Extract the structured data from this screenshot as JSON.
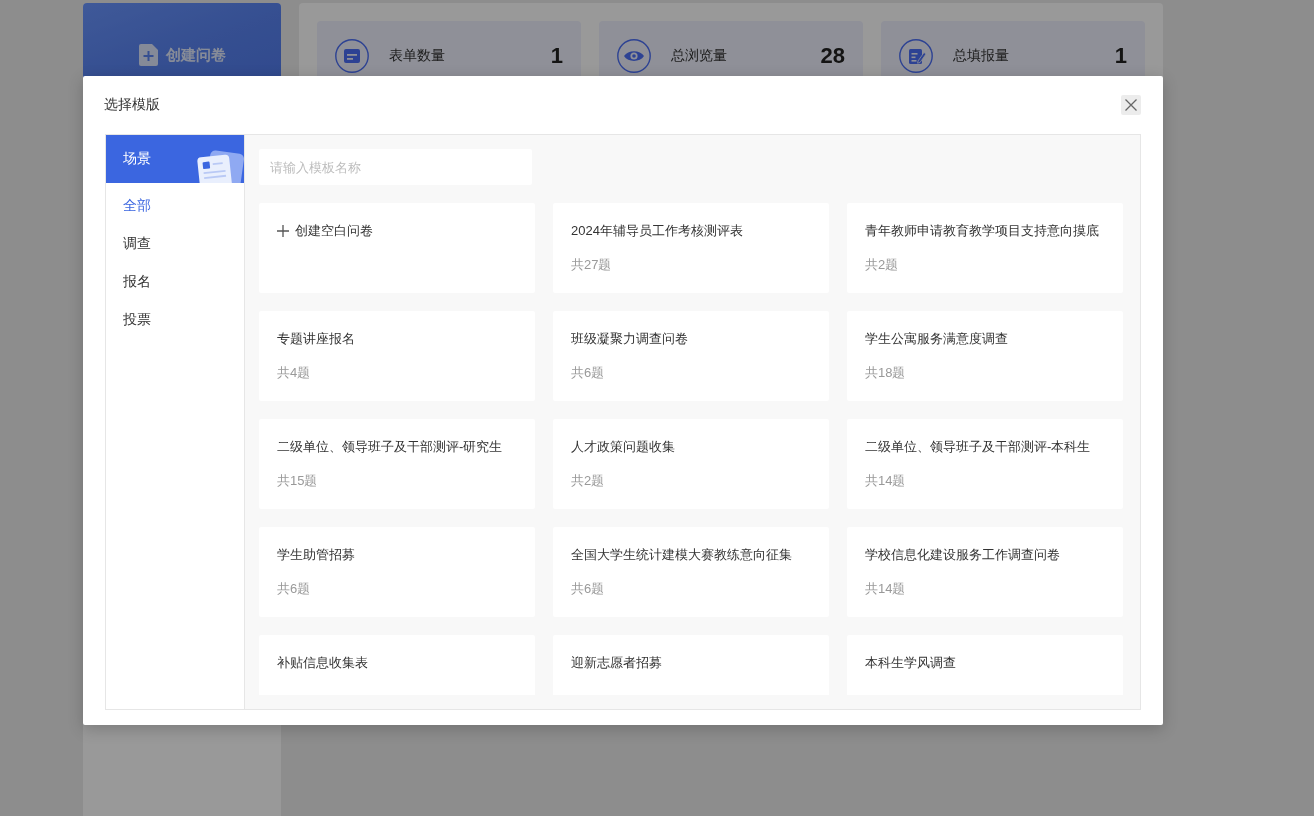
{
  "background": {
    "create_button": "创建问卷",
    "stats": [
      {
        "label": "表单数量",
        "value": "1"
      },
      {
        "label": "总浏览量",
        "value": "28"
      },
      {
        "label": "总填报量",
        "value": "1"
      }
    ]
  },
  "dialog": {
    "title": "选择模版",
    "category_header": "场景",
    "categories": [
      {
        "label": "全部",
        "selected": true
      },
      {
        "label": "调查",
        "selected": false
      },
      {
        "label": "报名",
        "selected": false
      },
      {
        "label": "投票",
        "selected": false
      }
    ],
    "search": {
      "placeholder": "请输入模板名称"
    },
    "templates": [
      {
        "kind": "blank",
        "title": "创建空白问卷"
      },
      {
        "kind": "template",
        "title": "2024年辅导员工作考核测评表",
        "count": "共27题"
      },
      {
        "kind": "template",
        "title": "青年教师申请教育教学项目支持意向摸底",
        "count": "共2题"
      },
      {
        "kind": "template",
        "title": "专题讲座报名",
        "count": "共4题"
      },
      {
        "kind": "template",
        "title": "班级凝聚力调查问卷",
        "count": "共6题"
      },
      {
        "kind": "template",
        "title": "学生公寓服务满意度调查",
        "count": "共18题"
      },
      {
        "kind": "template",
        "title": "二级单位、领导班子及干部测评-研究生",
        "count": "共15题"
      },
      {
        "kind": "template",
        "title": "人才政策问题收集",
        "count": "共2题"
      },
      {
        "kind": "template",
        "title": "二级单位、领导班子及干部测评-本科生",
        "count": "共14题"
      },
      {
        "kind": "template",
        "title": "学生助管招募",
        "count": "共6题"
      },
      {
        "kind": "template",
        "title": "全国大学生统计建模大赛教练意向征集",
        "count": "共6题"
      },
      {
        "kind": "template",
        "title": "学校信息化建设服务工作调查问卷",
        "count": "共14题"
      },
      {
        "kind": "template",
        "title": "补贴信息收集表"
      },
      {
        "kind": "template",
        "title": "迎新志愿者招募"
      },
      {
        "kind": "template",
        "title": "本科生学风调查"
      }
    ]
  }
}
